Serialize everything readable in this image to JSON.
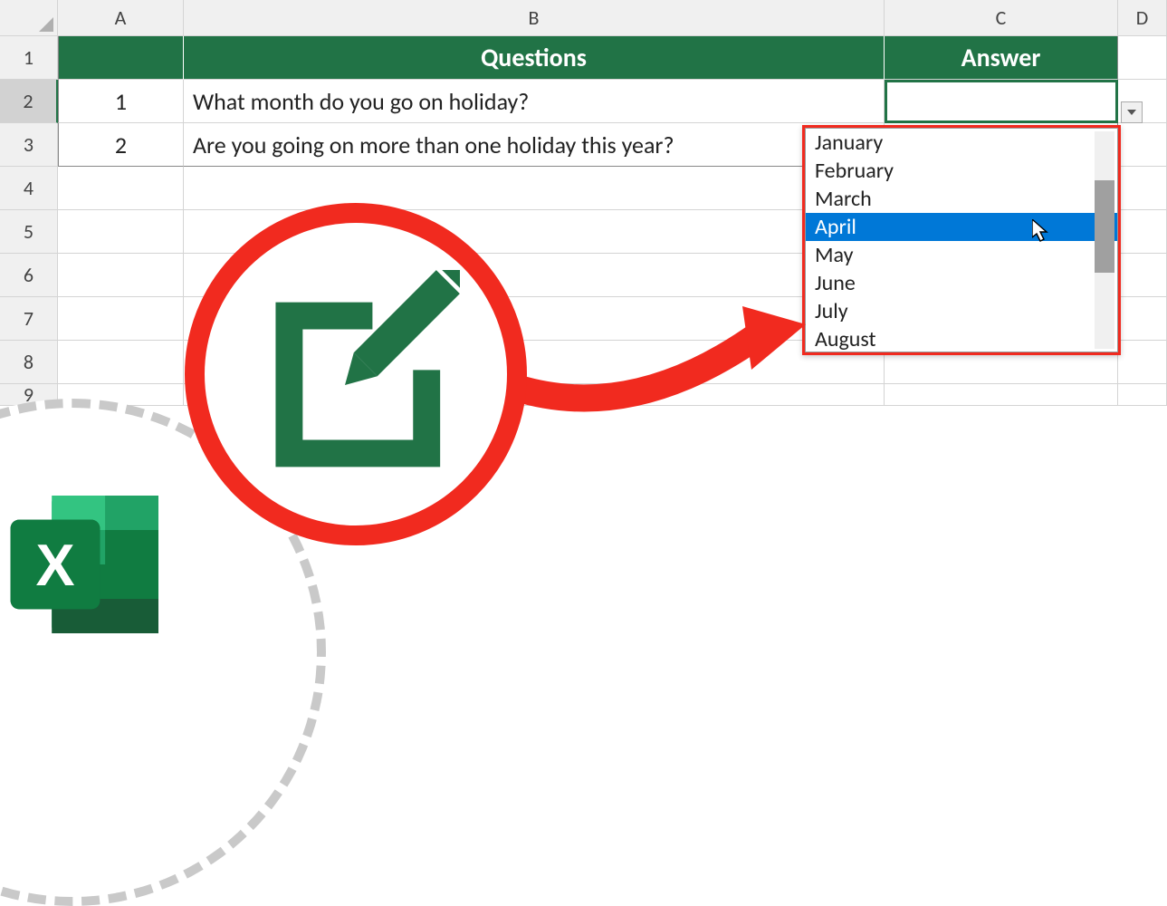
{
  "columns": {
    "A": "A",
    "B": "B",
    "C": "C",
    "D": "D"
  },
  "rows": [
    "1",
    "2",
    "3",
    "4",
    "5",
    "6",
    "7",
    "8",
    "9"
  ],
  "headers": {
    "questions": "Questions",
    "answer": "Answer"
  },
  "data": [
    {
      "num": "1",
      "question": "What month do you go on holiday?"
    },
    {
      "num": "2",
      "question": "Are you going on more than one holiday this year?"
    }
  ],
  "dropdown": {
    "items": [
      "January",
      "February",
      "March",
      "April",
      "May",
      "June",
      "July",
      "August"
    ],
    "highlighted": "April"
  },
  "colors": {
    "accent": "#217346",
    "highlight_red": "#f12a1f",
    "select_blue": "#0078d7"
  }
}
